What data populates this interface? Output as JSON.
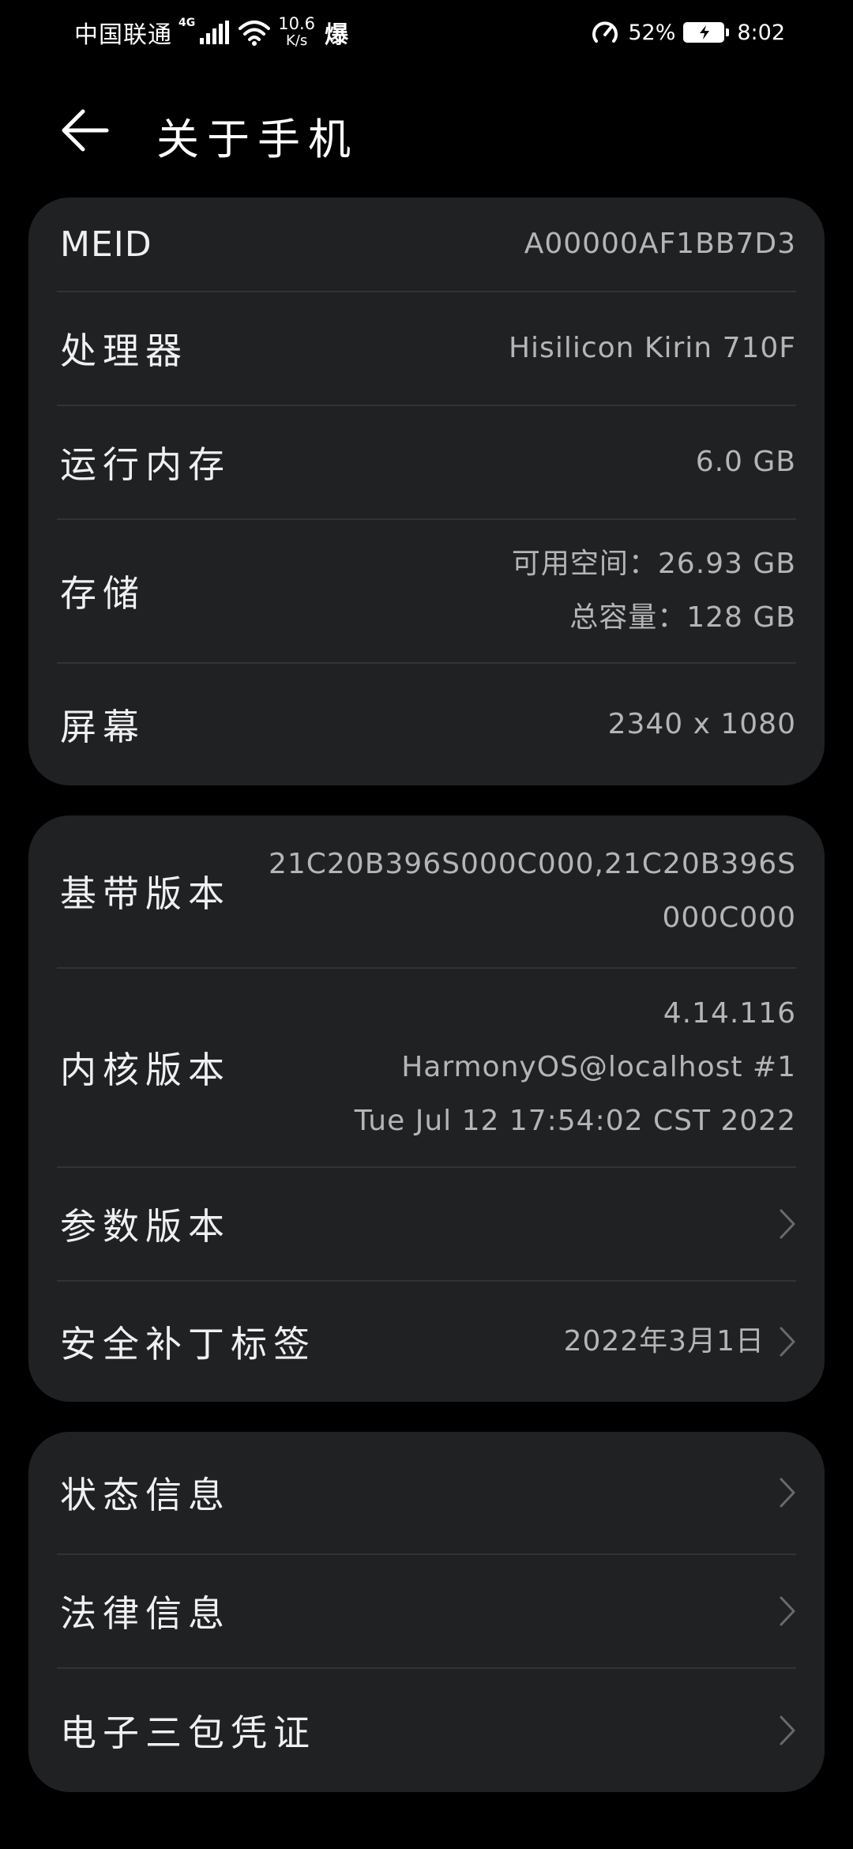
{
  "status_bar": {
    "carrier": "中国联通",
    "network_type": "4G",
    "speed_value": "10.6",
    "speed_unit": "K/s",
    "boost_label": "爆",
    "battery_percent": "52%",
    "time": "8:02",
    "battery_level": 0.52
  },
  "header": {
    "title": "关于手机"
  },
  "card1": {
    "meid": {
      "label": "MEID",
      "value": "A00000AF1BB7D3"
    },
    "processor": {
      "label": "处理器",
      "value": "Hisilicon Kirin 710F"
    },
    "ram": {
      "label": "运行内存",
      "value": "6.0 GB"
    },
    "storage": {
      "label": "存储",
      "available": "可用空间：26.93 GB",
      "total": "总容量：128 GB"
    },
    "screen": {
      "label": "屏幕",
      "value": "2340 x 1080"
    }
  },
  "card2": {
    "baseband": {
      "label": "基带版本",
      "value": "21C20B396S000C000,21C20B396S000C000"
    },
    "kernel": {
      "label": "内核版本",
      "line1": "4.14.116",
      "line2": "HarmonyOS@localhost #1",
      "line3": "Tue Jul 12 17:54:02 CST 2022"
    },
    "params": {
      "label": "参数版本"
    },
    "security_patch": {
      "label": "安全补丁标签",
      "value": "2022年3月1日"
    }
  },
  "card3": {
    "status_info": {
      "label": "状态信息"
    },
    "legal_info": {
      "label": "法律信息"
    },
    "warranty": {
      "label": "电子三包凭证"
    }
  },
  "colors": {
    "background": "#000000",
    "card": "#202123",
    "divider": "#323335",
    "label": "#f0f0f0",
    "value": "#b5b5b5",
    "chevron": "#6a6a6a"
  },
  "icons": [
    "back-arrow-icon",
    "chevron-right-icon",
    "wifi-icon",
    "signal-icon",
    "battery-icon",
    "power-saving-gauge-icon"
  ]
}
